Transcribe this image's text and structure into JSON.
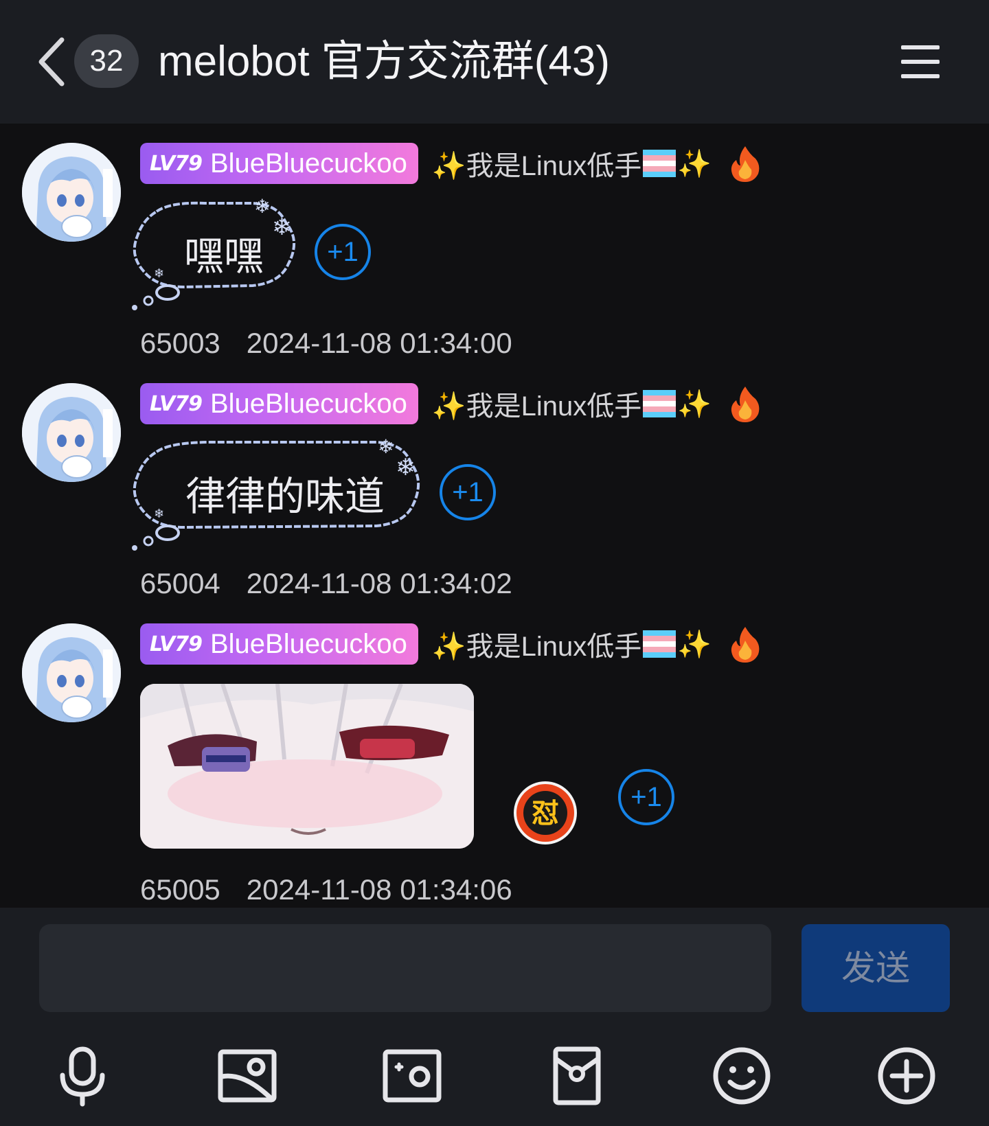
{
  "header": {
    "unread_count": "32",
    "title": "melobot 官方交流群(43)"
  },
  "messages": [
    {
      "level": "LV79",
      "nickname": "BlueBluecuckoo",
      "title_before": "✨我是Linux低手",
      "title_after": "✨",
      "text": "嘿嘿",
      "plus_one": "+1",
      "id": "65003",
      "time": "2024-11-08 01:34:00"
    },
    {
      "level": "LV79",
      "nickname": "BlueBluecuckoo",
      "title_before": "✨我是Linux低手",
      "title_after": "✨",
      "text": "律律的味道",
      "plus_one": "+1",
      "id": "65004",
      "time": "2024-11-08 01:34:02"
    },
    {
      "level": "LV79",
      "nickname": "BlueBluecuckoo",
      "title_before": "✨我是Linux低手",
      "title_after": "✨",
      "reaction_glyph": "怼",
      "plus_one": "+1",
      "id": "65005",
      "time": "2024-11-08 01:34:06"
    }
  ],
  "input": {
    "placeholder": "",
    "value": "",
    "send_label": "发送"
  },
  "toolbar": {
    "icons": [
      "microphone-icon",
      "image-icon",
      "camera-icon",
      "red-packet-icon",
      "emoji-icon",
      "plus-icon"
    ]
  },
  "colors": {
    "background": "#101012",
    "header": "#1b1d22",
    "accent_blue": "#1684e8",
    "send_button": "#0f3a7a",
    "name_tag_gradient": [
      "#9a5cf0",
      "#f27adc"
    ]
  }
}
